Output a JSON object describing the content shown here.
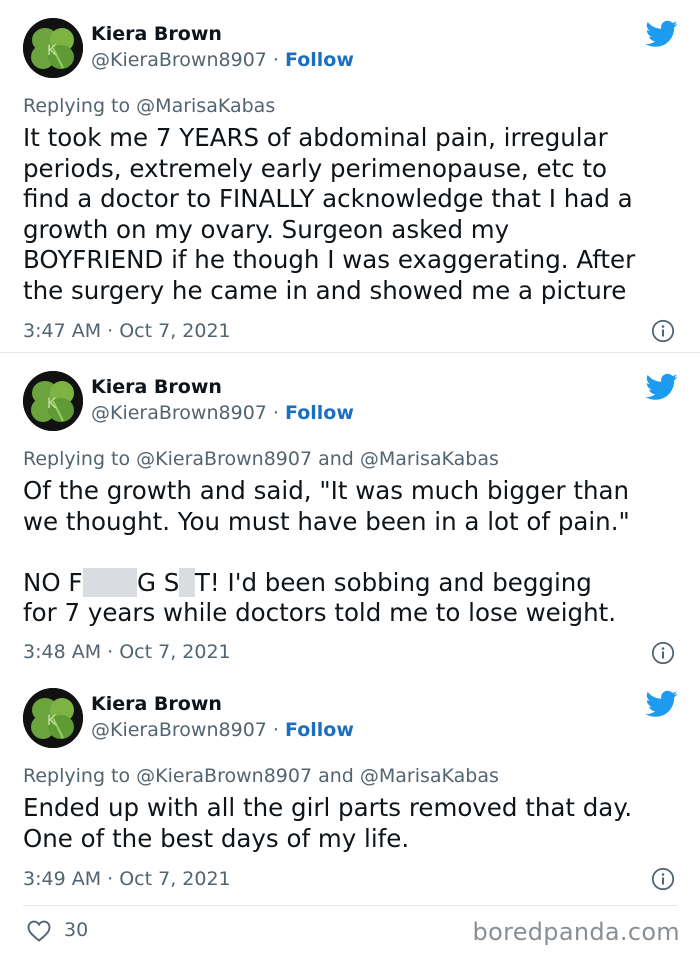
{
  "tweets": [
    {
      "name": "Kiera Brown",
      "handle": "@KieraBrown8907",
      "separator": "·",
      "follow_label": "Follow",
      "replying_prefix": "Replying to",
      "replying_to": "@MarisaKabas",
      "text": "It took me 7 YEARS of abdominal pain, irregular\nperiods, extremely early perimenopause, etc to\nfind a doctor to FINALLY acknowledge that I had a\ngrowth on my ovary. Surgeon asked my\nBOYFRIEND if he though I was exaggerating. After\nthe surgery he came in and showed me a picture",
      "timestamp": "3:47 AM · Oct 7, 2021"
    },
    {
      "name": "Kiera Brown",
      "handle": "@KieraBrown8907",
      "separator": "·",
      "follow_label": "Follow",
      "replying_prefix": "Replying to",
      "replying_to": "@KieraBrown8907 and @MarisaKabas",
      "text_line1": "Of the growth and said, \"It was much bigger than",
      "text_line2": "we thought. You must have been in a lot of pain.\"",
      "text_censored_a_pre": "NO F",
      "text_censored_a_post": "G S",
      "text_censored_b_post": "T! I'd been sobbing and begging",
      "text_line4": "for 7 years while doctors told me to lose weight.",
      "timestamp": "3:48 AM · Oct 7, 2021"
    },
    {
      "name": "Kiera Brown",
      "handle": "@KieraBrown8907",
      "separator": "·",
      "follow_label": "Follow",
      "replying_prefix": "Replying to",
      "replying_to": "@KieraBrown8907 and @MarisaKabas",
      "text": "Ended up with all the girl parts removed that day.\nOne of the best days of my life.",
      "timestamp": "3:49 AM · Oct 7, 2021"
    }
  ],
  "footer": {
    "likes": "30",
    "watermark": "boredpanda.com"
  },
  "colors": {
    "twitter_blue": "#1d9bf0",
    "link_blue": "#1b6fc1",
    "muted": "#536471",
    "avatar_green": "#6ba33c"
  },
  "icons": [
    "twitter-bird-icon",
    "info-icon",
    "heart-icon",
    "clover-avatar"
  ]
}
